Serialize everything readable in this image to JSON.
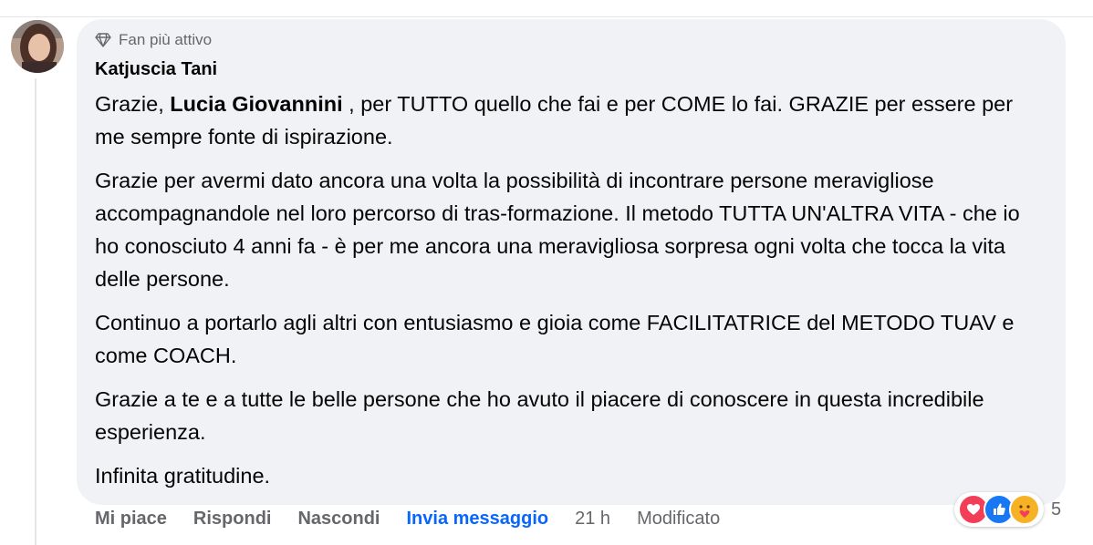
{
  "comment": {
    "badge": "Fan più attivo",
    "author": "Katjuscia Tani",
    "paragraphs": [
      {
        "before": "Grazie, ",
        "mention": "Lucia Giovannini",
        "after": " , per TUTTO quello che fai e per COME lo fai. GRAZIE per essere per me sempre fonte di ispirazione."
      },
      {
        "text": "Grazie per avermi dato ancora una volta la possibilità di incontrare persone meravigliose accompagnandole nel loro percorso di tras-formazione. Il metodo TUTTA UN'ALTRA VITA - che io ho conosciuto 4 anni fa - è per me ancora una meravigliosa sorpresa ogni volta che tocca la vita delle persone."
      },
      {
        "text": "Continuo a portarlo agli altri con entusiasmo e gioia come FACILITATRICE del METODO TUAV e come COACH."
      },
      {
        "text": "Grazie a te e a tutte le belle persone che ho avuto il piacere di conoscere in questa incredibile esperienza."
      },
      {
        "text": "Infinita gratitudine."
      }
    ]
  },
  "actions": {
    "like": "Mi piace",
    "reply": "Rispondi",
    "hide": "Nascondi",
    "message": "Invia messaggio",
    "time": "21 h",
    "edited": "Modificato"
  },
  "reactions": {
    "icons": [
      "heart-icon",
      "like-icon",
      "care-icon"
    ],
    "count": "5"
  },
  "colors": {
    "bubble": "#f0f2f5",
    "link": "#0866ff",
    "secondary_text": "#65676b",
    "love": "#f33e58",
    "like": "#1877f2",
    "care": "#f7b125"
  }
}
